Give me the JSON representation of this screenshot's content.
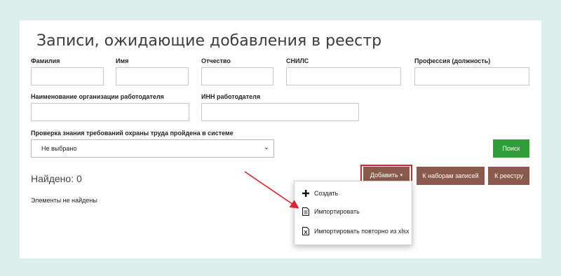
{
  "page": {
    "title": "Записи, ожидающие добавления в реестр"
  },
  "filters": {
    "last_name_label": "Фамилия",
    "first_name_label": "Имя",
    "patronymic_label": "Отчество",
    "snils_label": "СНИЛС",
    "profession_label": "Профессия (должность)",
    "employer_name_label": "Наименование организации работодателя",
    "employer_inn_label": "ИНН работодателя",
    "check_label": "Проверка знания требований охраны труда пройдена в системе",
    "check_value": "Не выбрано"
  },
  "buttons": {
    "search": "Поиск",
    "add": "Добавить",
    "to_sets": "К наборам записей",
    "to_registry": "К реестру"
  },
  "results": {
    "found": "Найдено: 0",
    "empty": "Элементы не найдены"
  },
  "add_menu": {
    "items": [
      {
        "label": "Создать",
        "icon": "plus-icon"
      },
      {
        "label": "Импортировать",
        "icon": "document-icon"
      },
      {
        "label": "Импортировать повторно из xlsx",
        "icon": "excel-file-icon"
      }
    ]
  },
  "colors": {
    "background": "#dcefec",
    "search_button": "#2f9e3a",
    "brown_button": "#8a5a4c",
    "highlight": "#e0222e"
  }
}
